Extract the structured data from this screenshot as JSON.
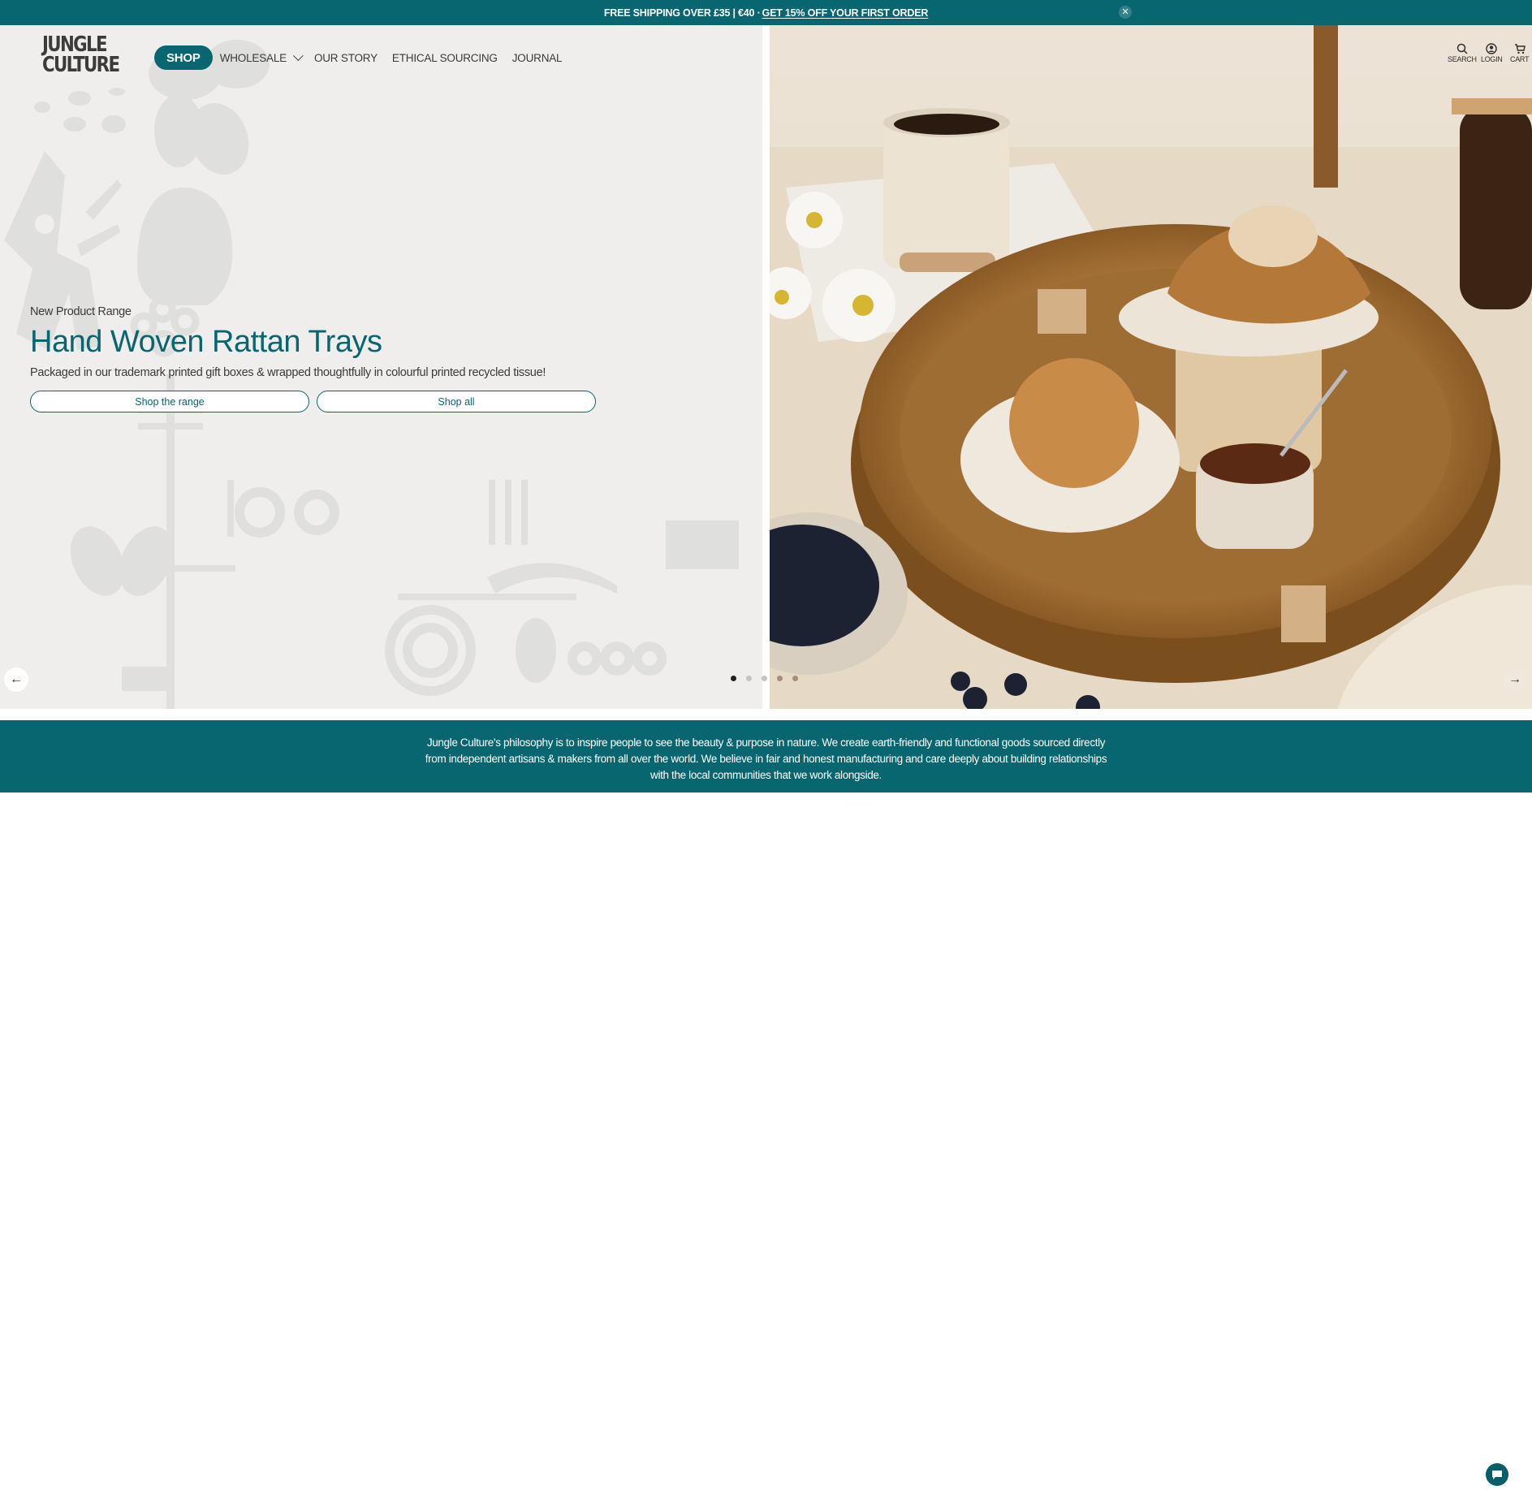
{
  "announcement": {
    "text": "FREE SHIPPING OVER £35 | €40 ·",
    "promo_link": "GET 15% OFF YOUR FIRST ORDER",
    "close_icon": "close-icon"
  },
  "header": {
    "logo": {
      "line1": "JUNGLE",
      "line2": "CULTURE"
    },
    "nav": [
      {
        "label": "SHOP",
        "active": true
      },
      {
        "label": "WHOLESALE",
        "has_dropdown": true
      },
      {
        "label": "OUR STORY"
      },
      {
        "label": "ETHICAL SOURCING"
      },
      {
        "label": "JOURNAL"
      }
    ],
    "utilities": [
      {
        "label": "SEARCH",
        "icon": "search-icon"
      },
      {
        "label": "LOGIN",
        "icon": "user-icon"
      },
      {
        "label": "CART",
        "icon": "cart-icon"
      }
    ]
  },
  "hero": {
    "eyebrow": "New Product Range",
    "title": "Hand Woven Rattan Trays",
    "subtitle": "Packaged in our trademark printed gift boxes & wrapped thoughtfully in colourful printed recycled tissue!",
    "buttons": [
      {
        "label": "Shop the range"
      },
      {
        "label": "Shop all"
      }
    ],
    "image_alt": "Round hand woven rattan tray with pastries, jam and coffee",
    "slides": {
      "count": 5,
      "active": 1
    },
    "prev_icon": "arrow-left-icon",
    "next_icon": "arrow-right-icon"
  },
  "about": {
    "text": "Jungle Culture's philosophy is to inspire people to see the beauty & purpose in nature. We create earth-friendly and functional goods sourced directly from independent artisans & makers from all over the world. We believe in fair and honest manufacturing and care deeply about building relationships with the local communities that we work alongside."
  },
  "chat": {
    "icon": "chat-icon"
  },
  "colors": {
    "brand_teal": "#07666f",
    "hero_bg": "#efeeec",
    "text_dark": "#3a3a3a"
  }
}
